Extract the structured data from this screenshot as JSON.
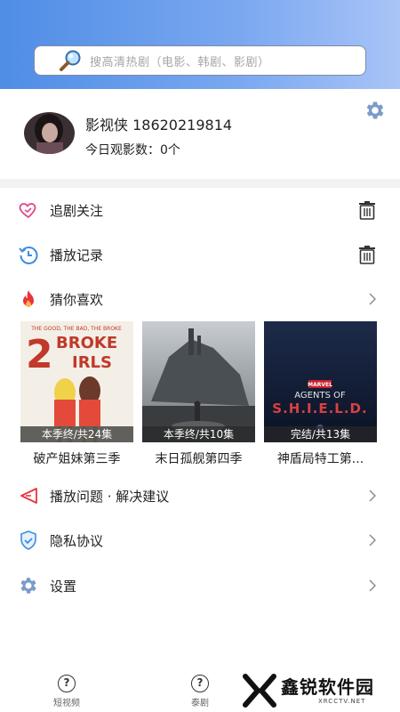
{
  "search": {
    "placeholder": "搜高清热剧（电影、韩剧、影剧）"
  },
  "profile": {
    "name_line": "影视侠 18620219814",
    "watch_count": "今日观影数：0个"
  },
  "menu": {
    "follow": "追剧关注",
    "history": "播放记录",
    "guess": "猜你喜欢",
    "feedback": "播放问题 · 解决建议",
    "privacy": "隐私协议",
    "settings": "设置"
  },
  "recommendations": [
    {
      "title": "破产姐妹第三季",
      "badge": "本季终/共24集",
      "poster_text": "2 BROKE GIRLS",
      "poster_caption": "THE GOOD, THE BAD, THE BROKE"
    },
    {
      "title": "末日孤舰第四季",
      "badge": "本季终/共10集"
    },
    {
      "title": "神盾局特工第...",
      "badge": "完结/共13集",
      "poster_text": "AGENTS OF S.H.I.E.L.D.",
      "poster_caption": "MARVEL"
    }
  ],
  "bottom_nav": [
    {
      "label": "短视频",
      "icon": "?"
    },
    {
      "label": "泰剧",
      "icon": "?"
    }
  ],
  "watermark": {
    "brand": "鑫锐软件园",
    "url": "XRCCTV.NET"
  },
  "colors": {
    "header_start": "#4f8de6",
    "header_end": "#a9c4f7",
    "accent_blue": "#3d8de0",
    "accent_red": "#e8343a"
  }
}
